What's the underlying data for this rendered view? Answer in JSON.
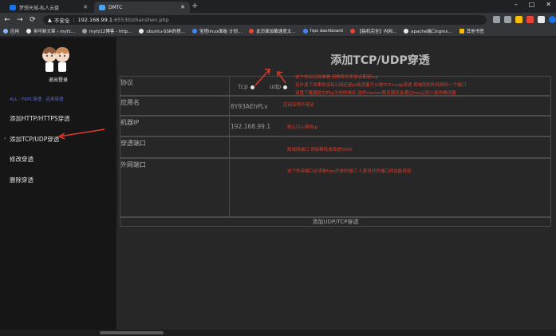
{
  "tabs": [
    {
      "label": "梦想天城-私人云盘",
      "color": "#1a73e8"
    },
    {
      "label": "DMTC",
      "color": "#4aa3f0"
    }
  ],
  "address": {
    "warning": "不安全",
    "host": "192.168.99.1",
    "path": ":65530/zhanshen.php"
  },
  "bookmarks": [
    {
      "label": "应用",
      "color": "#8ab4f8"
    },
    {
      "label": "帝可新文章 › myfz...",
      "color": "#e8eaed"
    },
    {
      "label": "myfz12博客 - http...",
      "color": "#9aa0a6"
    },
    {
      "label": "ubuntu-SSR的搭...",
      "color": "#e8eaed"
    },
    {
      "label": "宝塔linux面板 计划...",
      "color": "#4285f4"
    },
    {
      "label": "此页面加载速度太...",
      "color": "#ea4335"
    },
    {
      "label": "frps dashboard",
      "color": "#4285f4"
    },
    {
      "label": "【搞机完全】内网...",
      "color": "#ea4335"
    },
    {
      "label": "apache端口nginx...",
      "color": "#e8eaed"
    },
    {
      "label": "其他书签",
      "color": "#fbbc04"
    }
  ],
  "sidebar": {
    "logout": "退出登录",
    "breadcrumb": "ALL · FRPC穿透 · 应用穿透",
    "items": [
      "添加HTTP/HTTPS穿透",
      "添加TCP/UDP穿透",
      "修改穿透",
      "删除穿透"
    ]
  },
  "page_title": "添加TCP/UDP穿透",
  "form": {
    "protocol_label": "协议",
    "tcp_label": "tcp",
    "udp_label": "udp",
    "appname_label": "应用名",
    "appname_value": "8Y93AEhPLv",
    "ip_label": "机器IP",
    "ip_value": "192.168.99.1",
    "local_port_label": "穿透端口",
    "remote_port_label": "外网端口",
    "submit_label": "添加UDP/TCP穿透"
  },
  "notes": {
    "protocol_1": "这个协议比较准确 但群晖大多协议都是tcp",
    "protocol_2": "另外说下如果你没有公网还是pt搞流量可以做TCP+udp穿透 局域网和外网用同一个端口",
    "protocol_3": "设置下载器提交的ip为你的域名 这样tracker服务器就会通过frps让别人能你确流量",
    "appname": "应用名称不用动",
    "ip": "默认引入群晖ip",
    "local_port": "局域网端口 例如群晖桌面是5000",
    "remote_port": "这个外部端口必须是frps开放的端口 人家说开的端口你这能说用"
  },
  "colors": {
    "annotation": "#e03a2a",
    "accent": "#5b6bd6"
  }
}
